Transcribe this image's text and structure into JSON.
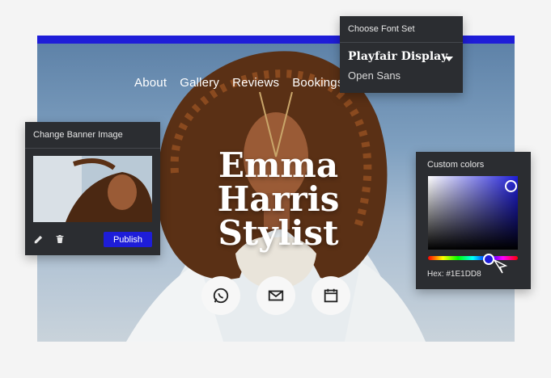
{
  "colors": {
    "accent": "#1E1DD8",
    "panel_bg": "#2B2D31"
  },
  "site": {
    "nav": [
      "About",
      "Gallery",
      "Reviews",
      "Bookings"
    ],
    "hero_title": [
      "Emma",
      "Harris",
      "Stylist"
    ],
    "contact_icons": [
      "whatsapp-icon",
      "mail-icon",
      "calendar-icon"
    ]
  },
  "font_panel": {
    "title": "Choose Font Set",
    "selected": "Playfair Display",
    "secondary": "Open Sans"
  },
  "banner_panel": {
    "title": "Change Banner Image",
    "publish_label": "Publish",
    "icons": [
      "pencil-icon",
      "trash-icon"
    ]
  },
  "color_panel": {
    "title": "Custom colors",
    "hex_label": "Hex: #1E1DD8"
  }
}
